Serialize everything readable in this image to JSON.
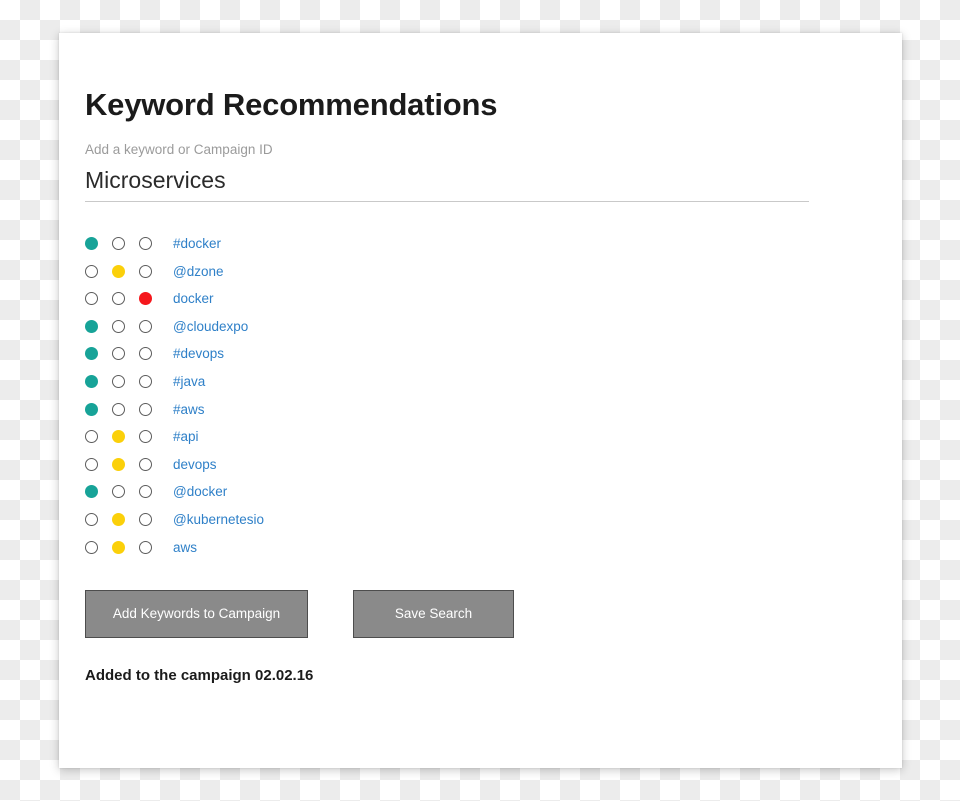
{
  "card": {
    "title": "Keyword Recommendations",
    "field": {
      "label": "Add a keyword or Campaign ID",
      "value": "Microservices",
      "placeholder": "Add a keyword or Campaign ID"
    },
    "keywords": [
      {
        "label": "#docker",
        "state": "green"
      },
      {
        "label": "@dzone",
        "state": "yellow"
      },
      {
        "label": "docker",
        "state": "red"
      },
      {
        "label": "@cloudexpo",
        "state": "green"
      },
      {
        "label": "#devops",
        "state": "green"
      },
      {
        "label": "#java",
        "state": "green"
      },
      {
        "label": "#aws",
        "state": "green"
      },
      {
        "label": "#api",
        "state": "yellow"
      },
      {
        "label": "devops",
        "state": "yellow"
      },
      {
        "label": "@docker",
        "state": "green"
      },
      {
        "label": "@kubernetesio",
        "state": "yellow"
      },
      {
        "label": "aws",
        "state": "yellow"
      }
    ],
    "buttons": {
      "add_keywords": "Add Keywords to Campaign",
      "save_search": "Save Search"
    },
    "status": "Added to the campaign 02.02.16"
  },
  "colors": {
    "green": "#17a398",
    "yellow": "#fbd00a",
    "red": "#f5171c",
    "empty": "#ffffff",
    "empty_border": "#5d5d5d",
    "link": "#2f80c8",
    "button_bg": "#8a8a8a",
    "button_border": "#4d4d4d"
  }
}
